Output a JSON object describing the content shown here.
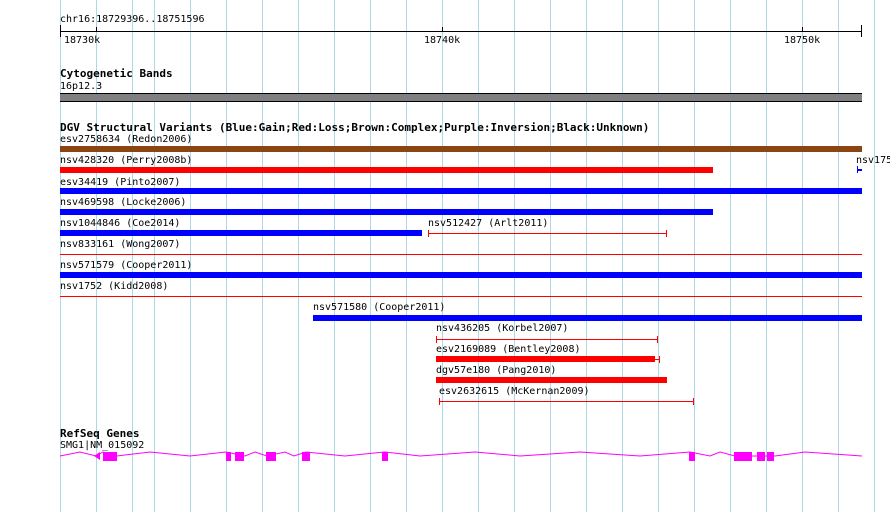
{
  "ruler": {
    "location": "chr16:18729396..18751596",
    "ticks": [
      "18730k",
      "18740k",
      "18750k"
    ]
  },
  "tracks": {
    "cytoband": {
      "title": "Cytogenetic Bands",
      "band_label": "16p12.3",
      "band_color": "#808080"
    },
    "dgv": {
      "title": "DGV Structural Variants (Blue:Gain;Red:Loss;Brown:Complex;Purple:Inversion;Black:Unknown)",
      "colors": {
        "gain": "#0000ff",
        "loss": "#ff0000",
        "complex": "#8b4513"
      },
      "features": [
        {
          "id": "esv2758634",
          "label": "esv2758634 (Redon2006)",
          "type": "complex"
        },
        {
          "id": "nsv428320",
          "label": "nsv428320 (Perry2008b)",
          "type": "loss"
        },
        {
          "id": "nsv175",
          "label": "nsv175",
          "type": "gain"
        },
        {
          "id": "esv34419",
          "label": "esv34419 (Pinto2007)",
          "type": "gain"
        },
        {
          "id": "nsv469598",
          "label": "nsv469598 (Locke2006)",
          "type": "gain"
        },
        {
          "id": "nsv1044846",
          "label": "nsv1044846 (Coe2014)",
          "type": "gain"
        },
        {
          "id": "nsv512427",
          "label": "nsv512427 (Arlt2011)",
          "type": "loss"
        },
        {
          "id": "nsv833161",
          "label": "nsv833161 (Wong2007)",
          "type": "loss"
        },
        {
          "id": "nsv571579",
          "label": "nsv571579 (Cooper2011)",
          "type": "gain"
        },
        {
          "id": "nsv1752",
          "label": "nsv1752 (Kidd2008)",
          "type": "loss"
        },
        {
          "id": "nsv571580",
          "label": "nsv571580 (Cooper2011)",
          "type": "gain"
        },
        {
          "id": "nsv436205",
          "label": "nsv436205 (Korbel2007)",
          "type": "loss"
        },
        {
          "id": "esv2169089",
          "label": "esv2169089 (Bentley2008)",
          "type": "loss"
        },
        {
          "id": "dgv57e180",
          "label": "dgv57e180 (Pang2010)",
          "type": "loss"
        },
        {
          "id": "esv2632615",
          "label": "esv2632615 (McKernan2009)",
          "type": "loss"
        }
      ]
    },
    "refseq": {
      "title": "RefSeq Genes",
      "gene_label": "SMG1|NM_015092",
      "color": "#ff00ff"
    }
  }
}
